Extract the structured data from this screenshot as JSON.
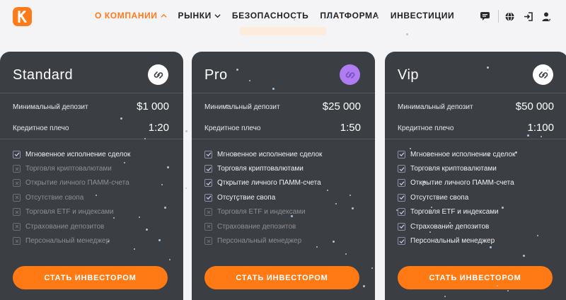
{
  "header": {
    "nav": [
      {
        "label": "О КОМПАНИИ",
        "active": true,
        "has_chevron": true
      },
      {
        "label": "РЫНКИ",
        "active": false,
        "has_chevron": true
      },
      {
        "label": "БЕЗОПАСНОСТЬ",
        "active": false,
        "has_chevron": false
      },
      {
        "label": "ПЛАТФОРМА",
        "active": false,
        "has_chevron": false
      },
      {
        "label": "ИНВЕСТИЦИИ",
        "active": false,
        "has_chevron": false
      }
    ],
    "icons": [
      "chat-icon",
      "language-globe-icon",
      "login-icon",
      "user-icon"
    ]
  },
  "plans": [
    {
      "name": "Standard",
      "badge_color": "#ffffff",
      "min_deposit_label": "Минимальный депозит",
      "min_deposit_value": "$1 000",
      "leverage_label": "Кредитное плечо",
      "leverage_value": "1:20",
      "features": [
        {
          "label": "Мгновенное исполнение сделок",
          "included": true
        },
        {
          "label": "Торговля криптовалютами",
          "included": false
        },
        {
          "label": "Открытие личного ПАММ-счета",
          "included": false
        },
        {
          "label": "Отсутствие свопа",
          "included": false
        },
        {
          "label": "Торговля ETF и индексами",
          "included": false
        },
        {
          "label": "Страхование депозитов",
          "included": false
        },
        {
          "label": "Персональный менеджер",
          "included": false
        }
      ],
      "cta_label": "СТАТЬ ИНВЕСТОРОМ"
    },
    {
      "name": "Pro",
      "badge_color": "#b07cf2",
      "min_deposit_label": "Минимальный депозит",
      "min_deposit_value": "$25 000",
      "leverage_label": "Кредитное плечо",
      "leverage_value": "1:50",
      "features": [
        {
          "label": "Мгновенное исполнение сделок",
          "included": true
        },
        {
          "label": "Торговля криптовалютами",
          "included": true
        },
        {
          "label": "Открытие личного ПАММ-счета",
          "included": true
        },
        {
          "label": "Отсутствие свопа",
          "included": true
        },
        {
          "label": "Торговля ETF и индексами",
          "included": false
        },
        {
          "label": "Страхование депозитов",
          "included": false
        },
        {
          "label": "Персональный менеджер",
          "included": false
        }
      ],
      "cta_label": "СТАТЬ ИНВЕСТОРОМ"
    },
    {
      "name": "Vip",
      "badge_color": "#ffffff",
      "min_deposit_label": "Минимальный депозит",
      "min_deposit_value": "$50 000",
      "leverage_label": "Кредитное плечо",
      "leverage_value": "1:100",
      "features": [
        {
          "label": "Мгновенное исполнение сделок",
          "included": true
        },
        {
          "label": "Торговля криптовалютами",
          "included": true
        },
        {
          "label": "Открытие личного ПАММ-счета",
          "included": true
        },
        {
          "label": "Отсутствие свопа",
          "included": true
        },
        {
          "label": "Торговля ETF и индексами",
          "included": true
        },
        {
          "label": "Страхование депозитов",
          "included": true
        },
        {
          "label": "Персональный менеджер",
          "included": true
        }
      ],
      "cta_label": "СТАТЬ ИНВЕСТОРОМ"
    }
  ],
  "colors": {
    "accent": "#ff7a14",
    "card_bg": "#3b3e42",
    "page_bg": "#f4f4f6"
  }
}
